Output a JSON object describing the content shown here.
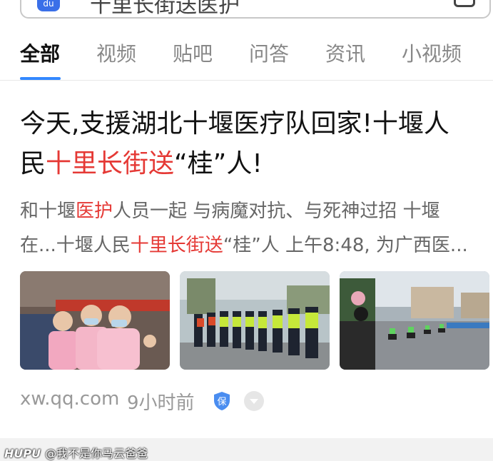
{
  "search": {
    "logo_text": "du",
    "query": "十里长街送医护"
  },
  "tabs": [
    {
      "label": "全部",
      "active": true
    },
    {
      "label": "视频",
      "active": false
    },
    {
      "label": "贴吧",
      "active": false
    },
    {
      "label": "问答",
      "active": false
    },
    {
      "label": "资讯",
      "active": false
    },
    {
      "label": "小视频",
      "active": false
    }
  ],
  "result": {
    "title_line1": "今天,支援湖北十堰医疗队回家!十堰人",
    "title_line2_prefix": "民",
    "title_line2_highlight": "十里长街送",
    "title_line2_suffix": "“桂”人!",
    "snippet_line1_a": "和十堰",
    "snippet_line1_highlight": "医护",
    "snippet_line1_b": "人员一起 与病魔对抗、与死神过招 十堰",
    "snippet_line2_a": "在...十堰人民",
    "snippet_line2_highlight": "十里长街送",
    "snippet_line2_b": "“桂”人 上午8:48, 为广西医...",
    "source": "xw.qq.com",
    "time": "9小时前",
    "badge": "保"
  },
  "watermark": {
    "brand": "HUPU",
    "user": "@我不是你马云爸爸"
  },
  "colors": {
    "accent": "#3388ff",
    "highlight": "#e53935"
  }
}
